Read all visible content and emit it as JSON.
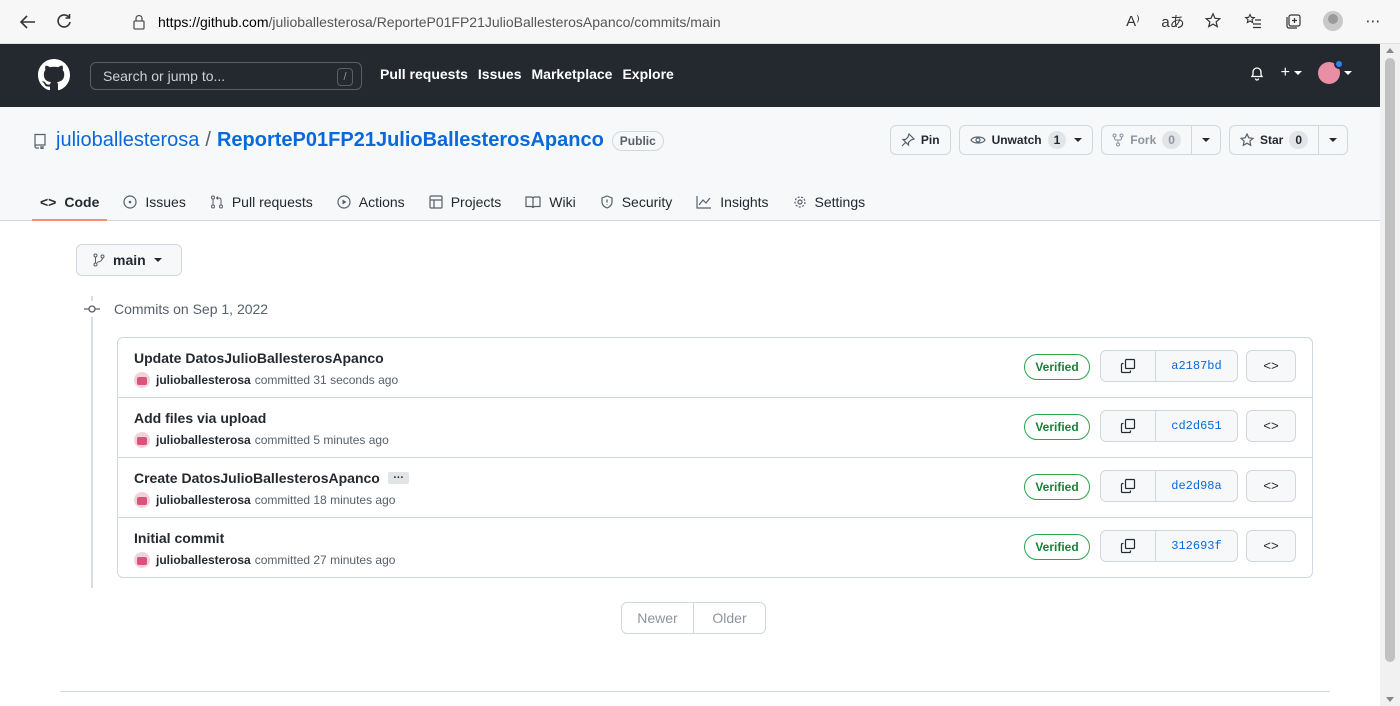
{
  "browser": {
    "url_host": "https://github.com",
    "url_path": "/julioballesterosa/ReporteP01FP21JulioBallesterosApanco/commits/main",
    "back_icon": "back-arrow-icon",
    "refresh_icon": "refresh-icon",
    "lock_icon": "lock-icon",
    "read_aloud": "A⁾",
    "translate": "aあ"
  },
  "header": {
    "search_placeholder": "Search or jump to...",
    "search_shortcut": "/",
    "nav": [
      "Pull requests",
      "Issues",
      "Marketplace",
      "Explore"
    ]
  },
  "repo": {
    "owner": "julioballesterosa",
    "separator": "/",
    "name": "ReporteP01FP21JulioBallesterosApanco",
    "visibility": "Public",
    "pin_label": "Pin",
    "watch_label": "Unwatch",
    "watch_count": "1",
    "fork_label": "Fork",
    "fork_count": "0",
    "star_label": "Star",
    "star_count": "0"
  },
  "tabs": [
    {
      "label": "Code",
      "icon": "code-icon"
    },
    {
      "label": "Issues",
      "icon": "issue-icon"
    },
    {
      "label": "Pull requests",
      "icon": "pull-request-icon"
    },
    {
      "label": "Actions",
      "icon": "play-icon"
    },
    {
      "label": "Projects",
      "icon": "table-icon"
    },
    {
      "label": "Wiki",
      "icon": "book-icon"
    },
    {
      "label": "Security",
      "icon": "shield-icon"
    },
    {
      "label": "Insights",
      "icon": "graph-icon"
    },
    {
      "label": "Settings",
      "icon": "gear-icon"
    }
  ],
  "branch": "main",
  "commits_heading": "Commits on Sep 1, 2022",
  "commits": [
    {
      "title": "Update DatosJulioBallesterosApanco",
      "author": "julioballesterosa",
      "time": "committed 31 seconds ago",
      "verified": "Verified",
      "sha": "a2187bd",
      "has_ellipsis": false,
      "browse": "<>"
    },
    {
      "title": "Add files via upload",
      "author": "julioballesterosa",
      "time": "committed 5 minutes ago",
      "verified": "Verified",
      "sha": "cd2d651",
      "has_ellipsis": false,
      "browse": "<>"
    },
    {
      "title": "Create DatosJulioBallesterosApanco",
      "author": "julioballesterosa",
      "time": "committed 18 minutes ago",
      "verified": "Verified",
      "sha": "de2d98a",
      "has_ellipsis": true,
      "ellipsis": "…",
      "browse": "<>"
    },
    {
      "title": "Initial commit",
      "author": "julioballesterosa",
      "time": "committed 27 minutes ago",
      "verified": "Verified",
      "sha": "312693f",
      "has_ellipsis": false,
      "browse": "<>"
    }
  ],
  "pager": {
    "newer": "Newer",
    "older": "Older"
  },
  "colors": {
    "accent": "#0969da",
    "header_bg": "#24292f",
    "verified": "#1a7f37",
    "tab_underline": "#fd8c73"
  }
}
